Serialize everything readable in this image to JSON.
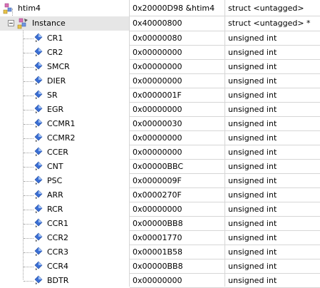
{
  "root": {
    "name": "htim4",
    "value": "0x20000D98 &htim4",
    "type": "struct <untagged>",
    "icon": "struct-variable-icon"
  },
  "instance": {
    "name": "Instance",
    "value": "0x40000800",
    "type": "struct <untagged> *",
    "icon": "struct-pointer-icon"
  },
  "registers": [
    {
      "name": "CR1",
      "value": "0x00000080",
      "type": "unsigned int"
    },
    {
      "name": "CR2",
      "value": "0x00000000",
      "type": "unsigned int"
    },
    {
      "name": "SMCR",
      "value": "0x00000000",
      "type": "unsigned int"
    },
    {
      "name": "DIER",
      "value": "0x00000000",
      "type": "unsigned int"
    },
    {
      "name": "SR",
      "value": "0x0000001F",
      "type": "unsigned int"
    },
    {
      "name": "EGR",
      "value": "0x00000000",
      "type": "unsigned int"
    },
    {
      "name": "CCMR1",
      "value": "0x00000030",
      "type": "unsigned int"
    },
    {
      "name": "CCMR2",
      "value": "0x00000000",
      "type": "unsigned int"
    },
    {
      "name": "CCER",
      "value": "0x00000000",
      "type": "unsigned int"
    },
    {
      "name": "CNT",
      "value": "0x00000BBC",
      "type": "unsigned int"
    },
    {
      "name": "PSC",
      "value": "0x0000009F",
      "type": "unsigned int"
    },
    {
      "name": "ARR",
      "value": "0x0000270F",
      "type": "unsigned int"
    },
    {
      "name": "RCR",
      "value": "0x00000000",
      "type": "unsigned int"
    },
    {
      "name": "CCR1",
      "value": "0x00000BB8",
      "type": "unsigned int"
    },
    {
      "name": "CCR2",
      "value": "0x00001770",
      "type": "unsigned int"
    },
    {
      "name": "CCR3",
      "value": "0x00001B58",
      "type": "unsigned int"
    },
    {
      "name": "CCR4",
      "value": "0x00000BB8",
      "type": "unsigned int"
    },
    {
      "name": "BDTR",
      "value": "0x00000000",
      "type": "unsigned int"
    }
  ],
  "register_icon": "variable-icon",
  "colors": {
    "selection": "#e6e6e6",
    "grid": "#d6d6d6",
    "variable_icon": "#3b6fd4"
  }
}
